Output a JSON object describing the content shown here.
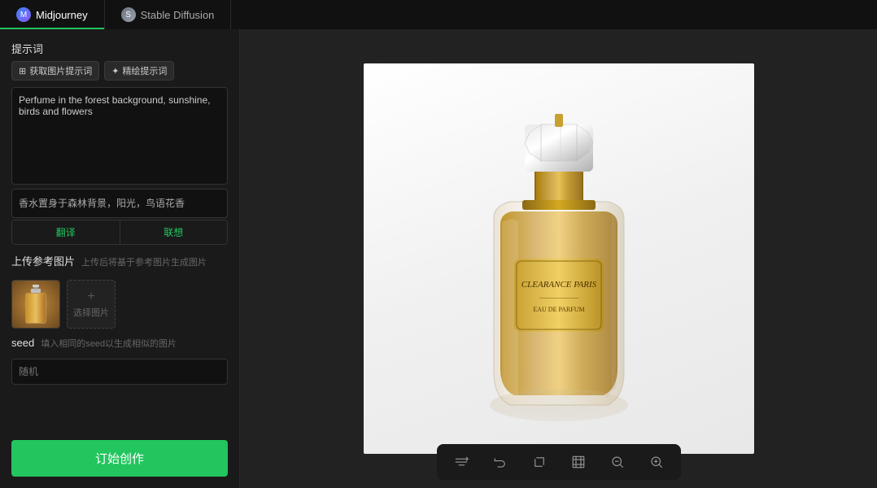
{
  "tabs": [
    {
      "id": "midjourney",
      "label": "Midjourney",
      "active": true,
      "icon": "M"
    },
    {
      "id": "stable-diffusion",
      "label": "Stable Diffusion",
      "active": false,
      "icon": "S"
    }
  ],
  "left_panel": {
    "prompt_section": {
      "title": "提示词",
      "extract_btn": "获取图片提示词",
      "refine_btn": "精绘提示词",
      "prompt_value": "Perfume in the forest background, sunshine, birds and flowers",
      "chinese_prompt": "香水置身于森林背景，阳光，鸟语花香",
      "translate_btn": "翻译",
      "copy_btn": "联想"
    },
    "upload_section": {
      "title": "上传参考图片",
      "subtitle": "上传后将基于参考图片生成图片",
      "add_btn_label": "选择图片"
    },
    "seed_section": {
      "title": "seed",
      "subtitle": "填入相同的seed以生成相似的图片",
      "placeholder": "随机"
    },
    "generate_btn": "订始创作"
  },
  "toolbar": {
    "items": [
      {
        "id": "flip",
        "icon": "flip"
      },
      {
        "id": "undo",
        "icon": "undo"
      },
      {
        "id": "crop",
        "icon": "crop"
      },
      {
        "id": "frame",
        "icon": "frame"
      },
      {
        "id": "zoom-out",
        "icon": "zoom-out"
      },
      {
        "id": "zoom-in",
        "icon": "zoom-in"
      }
    ]
  }
}
